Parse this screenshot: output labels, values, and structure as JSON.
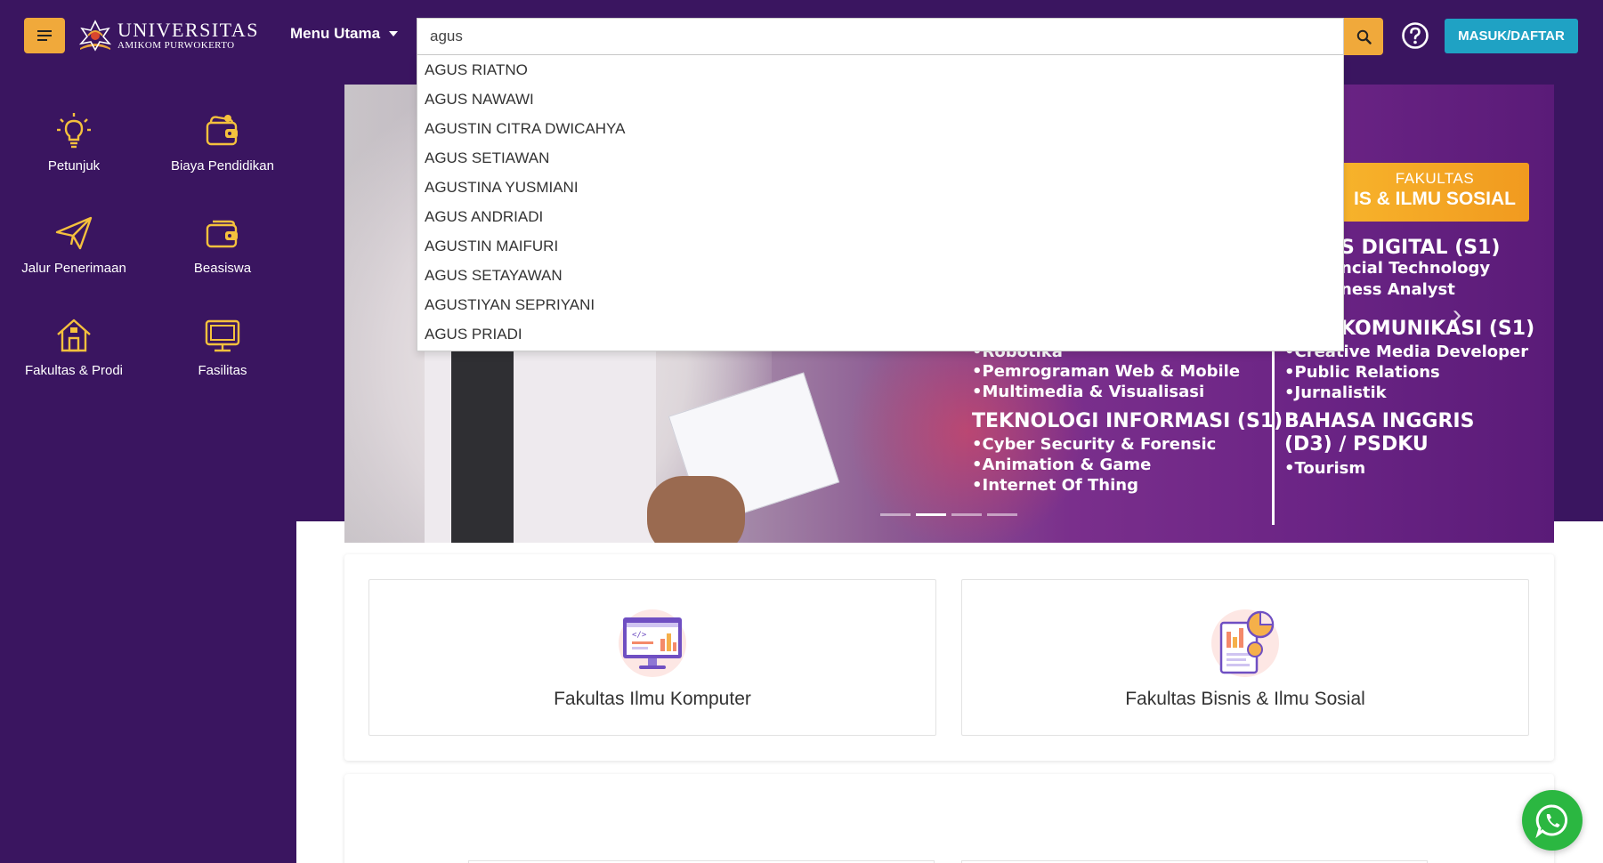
{
  "header": {
    "menu_icon": "menu-icon",
    "logo": {
      "line1": "UNIVERSITAS",
      "line2": "AMIKOM PURWOKERTO"
    },
    "menu_label": "Menu Utama",
    "search_value": "agus",
    "search_icon": "search-icon",
    "help_icon": "help-icon",
    "login_label": "MASUK/DAFTAR"
  },
  "sidebar": {
    "items": [
      {
        "label": "Petunjuk",
        "icon": "lightbulb-icon"
      },
      {
        "label": "Biaya Pendidikan",
        "icon": "wallet-icon"
      },
      {
        "label": "Jalur Penerimaan",
        "icon": "paper-plane-icon"
      },
      {
        "label": "Beasiswa",
        "icon": "wallet-icon"
      },
      {
        "label": "Fakultas & Prodi",
        "icon": "house-icon"
      },
      {
        "label": "Fasilitas",
        "icon": "monitor-icon"
      }
    ]
  },
  "autocomplete": {
    "items": [
      "AGUS RIATNO",
      "AGUS NAWAWI",
      "AGUSTIN CITRA DWICAHYA",
      "AGUS SETIAWAN",
      "AGUSTINA YUSMIANI",
      "AGUS ANDRIADI",
      "AGUSTIN MAIFURI",
      "AGUS SETAYAWAN",
      "AGUSTIYAN SEPRIYANI",
      "AGUS PRIADI"
    ]
  },
  "hero": {
    "badge_line1": "FAKULTAS",
    "badge_line2": "IS & ILMU SOSIAL",
    "col_left": {
      "partial_top": "•Robotika",
      "items": [
        "•Pemrograman Web & Mobile",
        "•Multimedia & Visualisasi"
      ],
      "heading2": "TEKNOLOGI INFORMASI (S1)",
      "items2": [
        "•Cyber Security & Forensic",
        "•Animation & Game",
        "•Internet Of Thing"
      ]
    },
    "col_right": {
      "heading1": "S DIGITAL (S1)",
      "items1": [
        "ncial Technology",
        "ness Analyst"
      ],
      "heading2": " KOMUNIKASI (S1)",
      "items2": [
        "•Creative Media Developer",
        "•Public Relations",
        "•Jurnalistik"
      ],
      "heading3a": "BAHASA INGGRIS",
      "heading3b": "(D3) / PSDKU",
      "items3": [
        "•Tourism"
      ]
    },
    "slides": 4,
    "active_slide": 2
  },
  "fakultas": [
    {
      "label": "Fakultas Ilmu Komputer",
      "icon": "computer-code-icon"
    },
    {
      "label": "Fakultas Bisnis & Ilmu Sosial",
      "icon": "business-chart-icon"
    }
  ],
  "whatsapp_icon": "whatsapp-icon",
  "colors": {
    "primary": "#3a1560",
    "accent": "#f0a93b",
    "login": "#1fa2c4",
    "whatsapp": "#2bb741"
  }
}
